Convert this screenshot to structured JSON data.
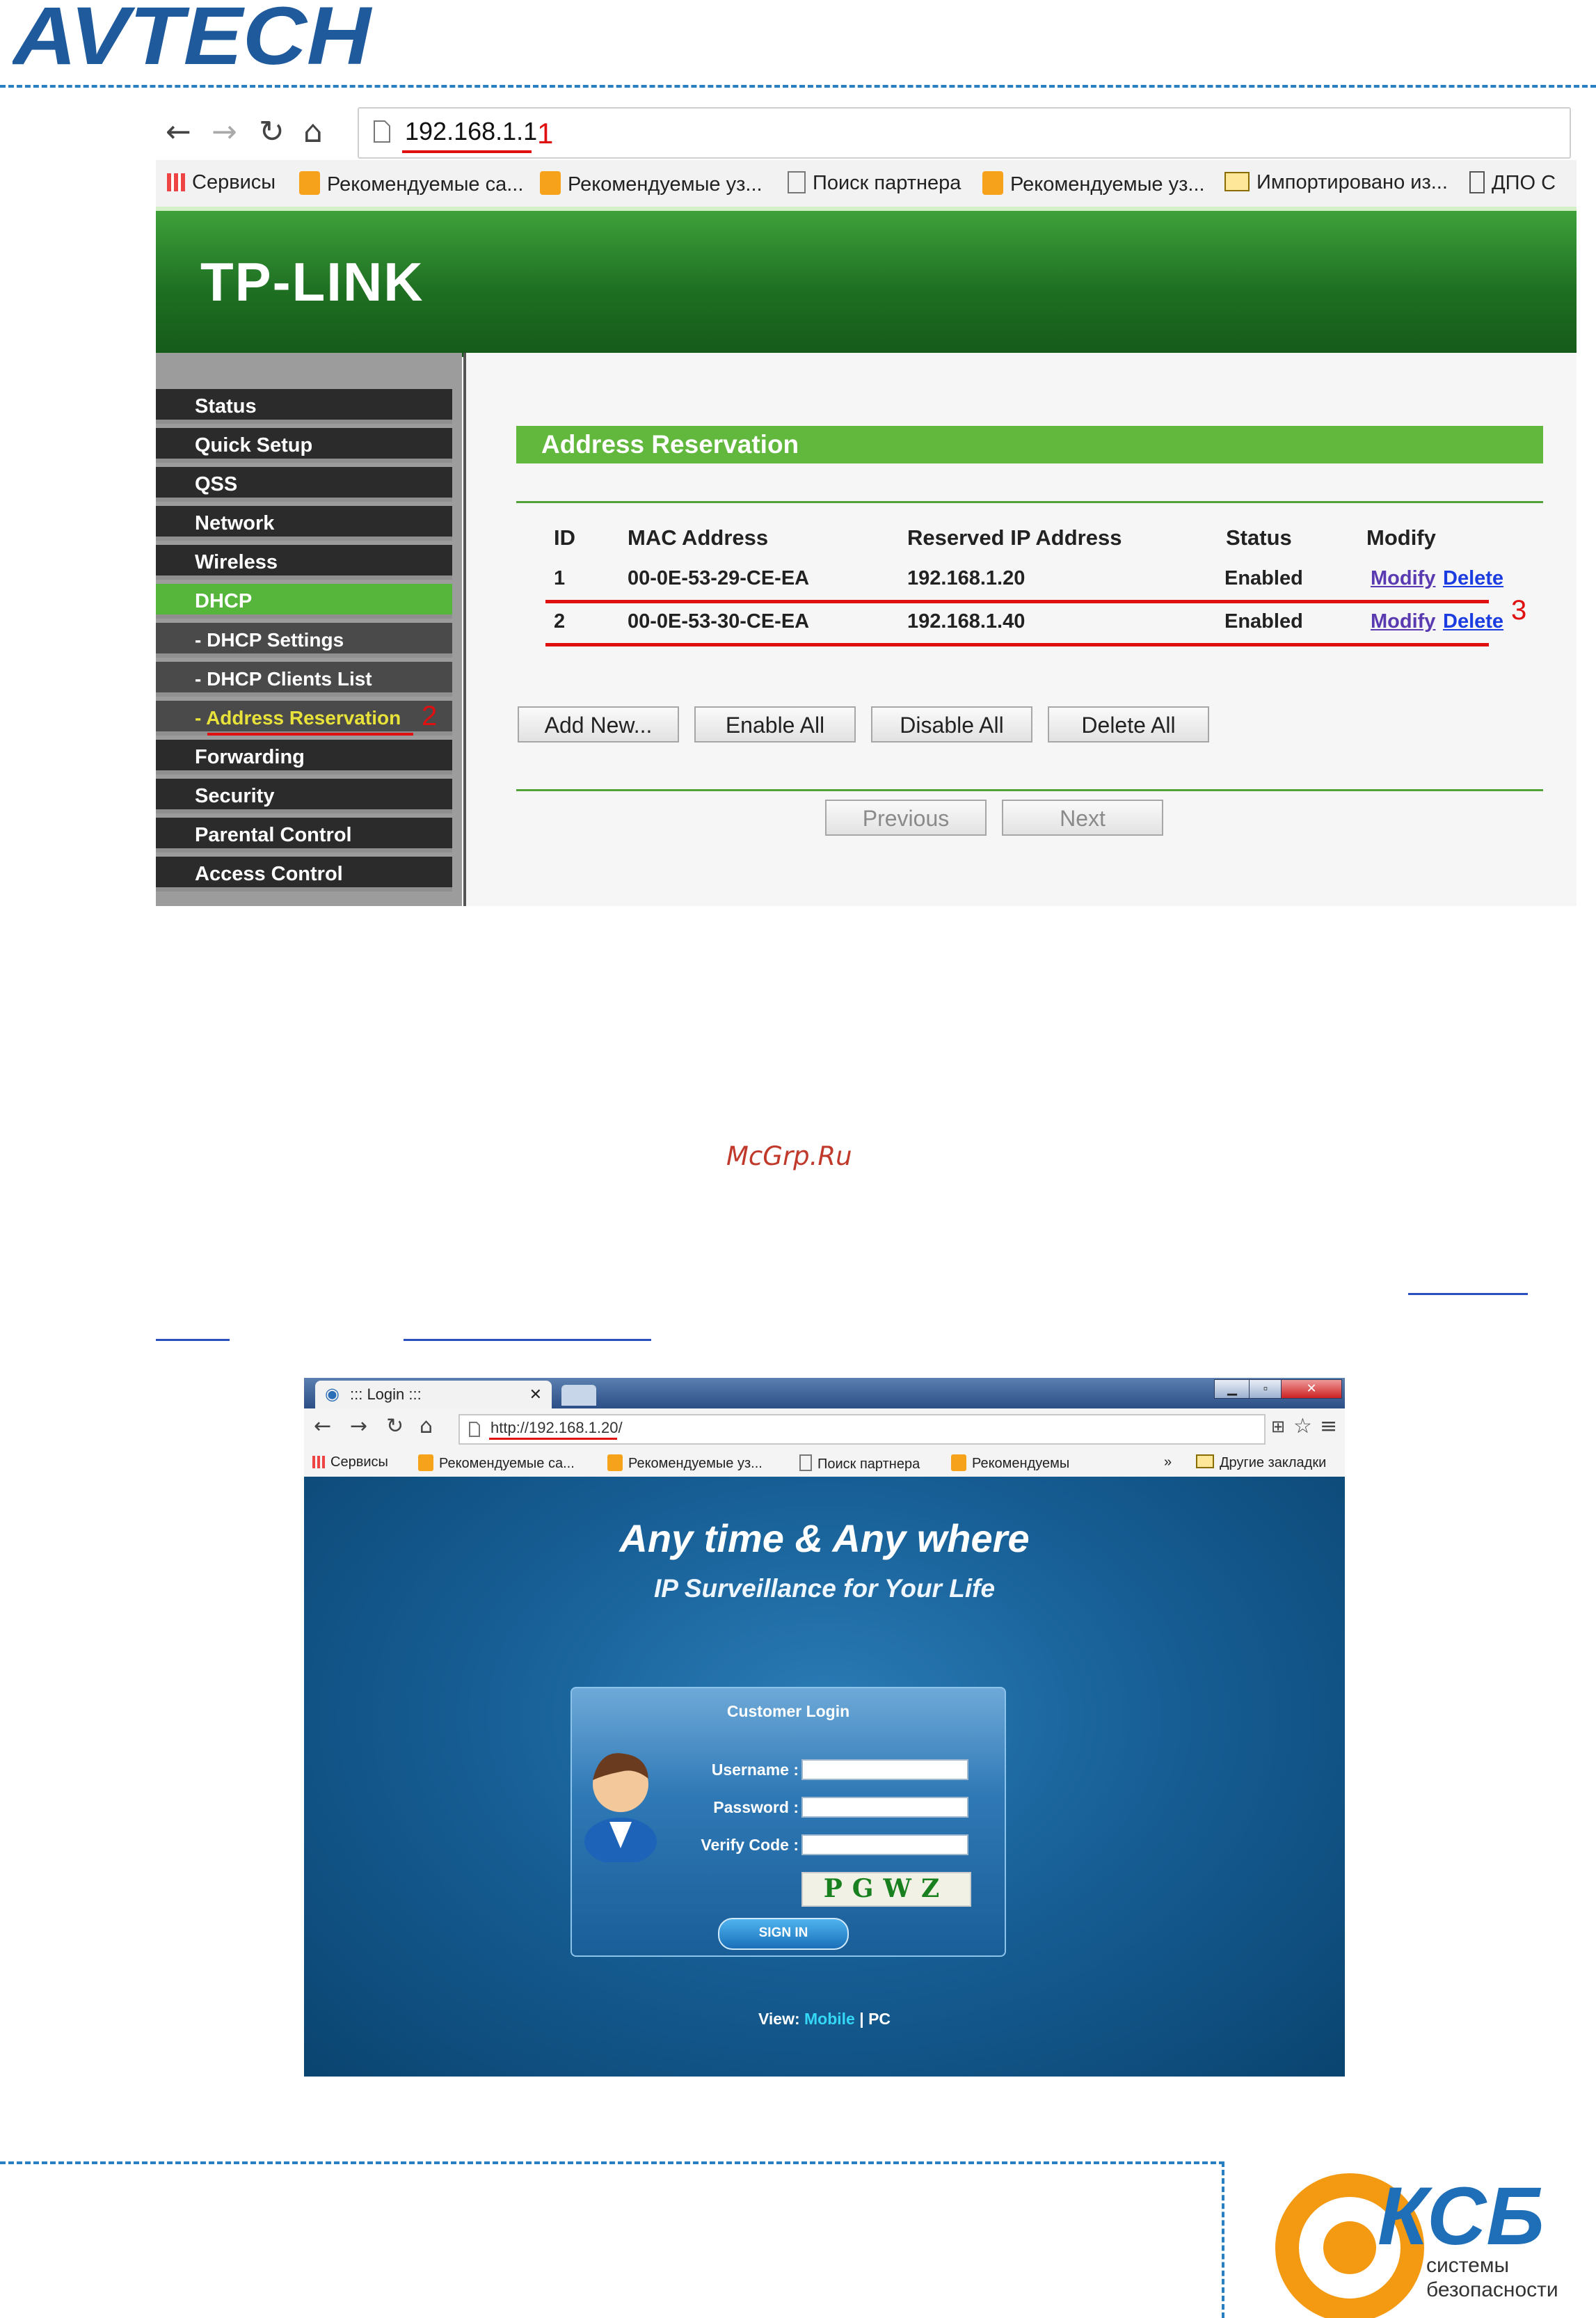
{
  "header": {
    "brand": "AVTECH"
  },
  "router_screenshot": {
    "address_bar": {
      "url": "192.168.1.1",
      "annotation": "1"
    },
    "bookmarks": [
      {
        "label": "Сервисы",
        "icon": "apps-grid-icon"
      },
      {
        "label": "Рекомендуемые са...",
        "icon": "bookmark-icon"
      },
      {
        "label": "Рекомендуемые уз...",
        "icon": "bookmark-icon"
      },
      {
        "label": "Поиск партнера",
        "icon": "page-icon"
      },
      {
        "label": "Рекомендуемые уз...",
        "icon": "bookmark-icon"
      },
      {
        "label": "Импортировано из...",
        "icon": "folder-icon"
      },
      {
        "label": "ДПО С",
        "icon": "page-icon"
      }
    ],
    "brand": "TP-LINK",
    "sidebar": [
      {
        "label": "Status"
      },
      {
        "label": "Quick Setup"
      },
      {
        "label": "QSS"
      },
      {
        "label": "Network"
      },
      {
        "label": "Wireless"
      },
      {
        "label": "DHCP"
      },
      {
        "label": "- DHCP Settings"
      },
      {
        "label": "- DHCP Clients List"
      },
      {
        "label": "- Address Reservation"
      },
      {
        "label": "Forwarding"
      },
      {
        "label": "Security"
      },
      {
        "label": "Parental Control"
      },
      {
        "label": "Access Control"
      }
    ],
    "sidebar_annotation": "2",
    "panel_title": "Address Reservation",
    "table": {
      "headers": [
        "ID",
        "MAC Address",
        "Reserved IP Address",
        "Status",
        "Modify"
      ],
      "rows": [
        {
          "id": "1",
          "mac": "00-0E-53-29-CE-EA",
          "ip": "192.168.1.20",
          "status": "Enabled",
          "modify": "Modify",
          "delete": "Delete"
        },
        {
          "id": "2",
          "mac": "00-0E-53-30-CE-EA",
          "ip": "192.168.1.40",
          "status": "Enabled",
          "modify": "Modify",
          "delete": "Delete"
        }
      ],
      "annotation": "3"
    },
    "buttons": {
      "add": "Add New...",
      "enable": "Enable All",
      "disable": "Disable All",
      "delete": "Delete All",
      "previous": "Previous",
      "next": "Next"
    }
  },
  "watermark": "McGrp.Ru",
  "login_screenshot": {
    "tab_title": "::: Login :::",
    "url": "http://192.168.1.20/",
    "bookmarks": [
      "Сервисы",
      "Рекомендуемые са...",
      "Рекомендуемые уз...",
      "Поиск партнера",
      "Рекомендуемы",
      "»",
      "Другие закладки"
    ],
    "slogan": "Any time & Any where",
    "subslogan": "IP Surveillance for Your Life",
    "login_title": "Customer Login",
    "username_label": "Username :",
    "password_label": "Password :",
    "verify_label": "Verify Code :",
    "captcha": "PGWZ",
    "signin": "SIGN IN",
    "view_label": "View:",
    "view_mobile": "Mobile",
    "view_sep": "|",
    "view_pc": "PC"
  },
  "footer": {
    "logo_text": "КСБ",
    "logo_sub1": "системы",
    "logo_sub2": "безопасности"
  },
  "colors": {
    "accent_blue": "#2a7fc0",
    "tplink_green": "#61b83d",
    "annotation_red": "#e01010"
  }
}
